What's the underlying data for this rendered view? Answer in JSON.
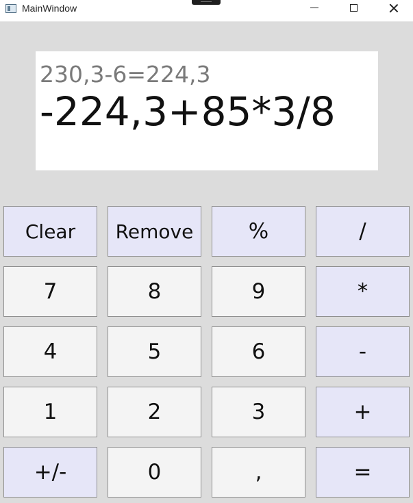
{
  "window": {
    "title": "MainWindow",
    "controls": {
      "minimize": "minimize",
      "maximize": "maximize",
      "close": "close"
    }
  },
  "display": {
    "history": "230,3-6=224,3",
    "expression": "-224,3+85*3/8"
  },
  "keypad": {
    "row1": [
      "Clear",
      "Remove",
      "%",
      "/"
    ],
    "row2": [
      "7",
      "8",
      "9",
      "*"
    ],
    "row3": [
      "4",
      "5",
      "6",
      "-"
    ],
    "row4": [
      "1",
      "2",
      "3",
      "+"
    ],
    "row5": [
      "+/-",
      "0",
      ",",
      "="
    ]
  },
  "colors": {
    "background": "#dcdcdc",
    "display_background": "#ffffff",
    "history_text": "#7a7a7a",
    "expression_text": "#111111",
    "number_key": "#f4f4f4",
    "operator_key": "#e6e6f8",
    "border": "#8f8f8f"
  }
}
